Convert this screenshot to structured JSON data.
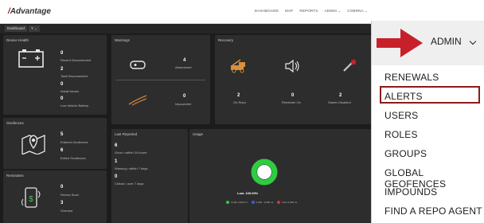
{
  "app": {
    "logo": "Advantage"
  },
  "topnav": [
    "DASHBOARD",
    "MAP",
    "REPORTS",
    "ADMIN ⌄",
    "COBRNA ⌄"
  ],
  "toolbar": {
    "dashboard_label": "Dashboard",
    "filter_label": "Y ⌄"
  },
  "device_health": {
    "title": "Device Health",
    "items": [
      {
        "value": "0",
        "label": "Recent Disconnected"
      },
      {
        "value": "2",
        "label": "Total Disconnected"
      },
      {
        "value": "0",
        "label": "Install Issues"
      },
      {
        "value": "0",
        "label": "Low Vehicle Battery"
      }
    ]
  },
  "warnings": {
    "title": "Warnings",
    "items": [
      {
        "value": "4",
        "label": "Abandoned"
      },
      {
        "value": "0",
        "label": "Impounded"
      }
    ]
  },
  "recovery": {
    "title": "Recovery",
    "items": [
      {
        "value": "2",
        "label": "On Repo"
      },
      {
        "value": "0",
        "label": "Reminder On"
      },
      {
        "value": "2",
        "label": "Starter Disabled"
      }
    ]
  },
  "geofences": {
    "title": "Geofences",
    "items": [
      {
        "value": "5",
        "label": "Entered Geofences"
      },
      {
        "value": "6",
        "label": "Exited Geofences"
      }
    ]
  },
  "reminders": {
    "title": "Reminders",
    "items": [
      {
        "value": "0",
        "label": "Renew Soon"
      },
      {
        "value": "3",
        "label": "Overdue"
      }
    ]
  },
  "last_reported": {
    "title": "Last Reported",
    "items": [
      {
        "value": "6",
        "label": "Good • within 24 hours"
      },
      {
        "value": "1",
        "label": "Warning • within 7 days"
      },
      {
        "value": "0",
        "label": "Critical • over 7 days"
      }
    ]
  },
  "usage": {
    "title": "Usage",
    "donut_label": "Low: 100.00%",
    "low_fraction": 1.0,
    "legend": [
      "Under 2,000 mi",
      "2,000 - 3,000 mi",
      "Over 3,000 mi"
    ],
    "colors": {
      "low": "#2ecc40",
      "mid": "#3b5bdb",
      "high": "#e03131"
    }
  },
  "admin": {
    "label": "ADMIN",
    "menu": [
      "RENEWALS",
      "ALERTS",
      "USERS",
      "ROLES",
      "GROUPS",
      "GLOBAL GEOFENCES",
      "IMPOUNDS",
      "FIND A REPO AGENT"
    ],
    "highlighted": "ALERTS",
    "highlight_color": "#8a1c1c",
    "arrow_color": "#c8202a"
  }
}
